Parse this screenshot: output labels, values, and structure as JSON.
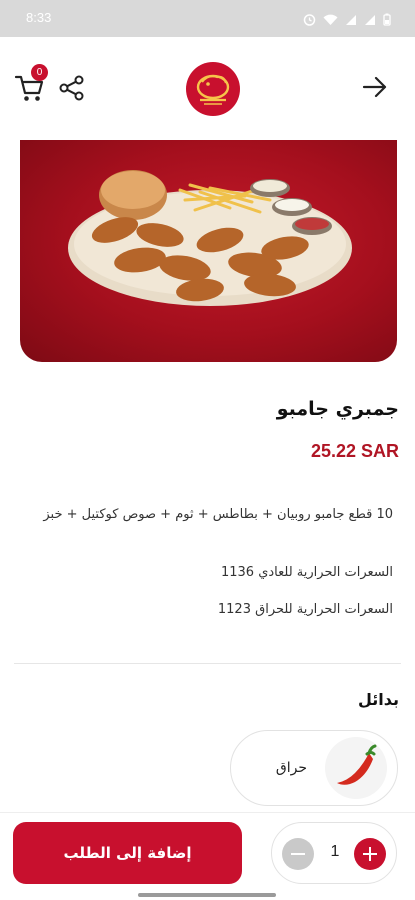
{
  "status_bar": {
    "time": "8:33"
  },
  "header": {
    "cart_count": "0"
  },
  "product": {
    "title": "جمبري جامبو",
    "price": "25.22 SAR",
    "description": "10 قطع جامبو روبيان + بطاطس + ثوم + صوص كوكتيل + خبز",
    "calories_normal": "السعرات الحرارية للعادي 1136",
    "calories_spicy": "السعرات الحرارية للحراق 1123"
  },
  "alternatives": {
    "title": "بدائل",
    "options": [
      {
        "label": "حراق",
        "icon": "chili-pepper-icon"
      }
    ]
  },
  "footer": {
    "add_label": "إضافة إلى الطلب",
    "quantity": "1"
  },
  "colors": {
    "brand": "#c8102e",
    "price": "#b01524",
    "banner": "#a40f1d"
  }
}
